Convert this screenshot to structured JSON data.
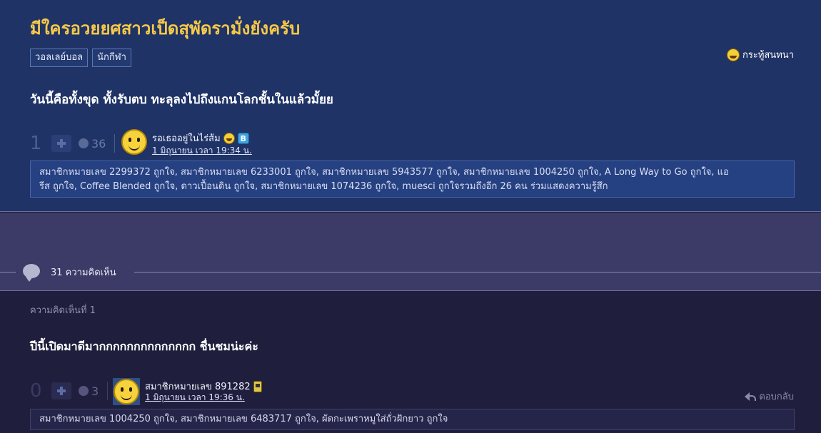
{
  "topic": {
    "title": "มีใครอวยยศสาวเป็ดสุพัดรามั่งยังครับ",
    "tags": [
      "วอลเลย์บอล",
      "นักกีฬา"
    ],
    "type_label": "กระทู้สนทนา",
    "subtitle": "วันนี้คือทั้งขุด ทั้งรับตบ ทะลุลงไปถึงแกนโลกชั้นในแล้วมั้ยย",
    "votes": "1",
    "reactions": "36",
    "author": "รอเธออยู่ในไร่ส้ม",
    "date": "1 มิถุนายน เวลา 19:34 น.",
    "likes_line1": "สมาชิกหมายเลข 2299372 ถูกใจ, สมาชิกหมายเลข 6233001 ถูกใจ, สมาชิกหมายเลข 5943577 ถูกใจ, สมาชิกหมายเลข 1004250 ถูกใจ, A Long Way to Go ถูกใจ, แอ",
    "likes_line2": "รีส ถูกใจ, Coffee Blended ถูกใจ, ดาวเปื้อนดิน ถูกใจ, สมาชิกหมายเลข 1074236 ถูกใจ, muesci ถูกใจรวมถึงอีก 26 คน ร่วมแสดงความรู้สึก"
  },
  "comments_count": "31 ความคิดเห็น",
  "comment": {
    "label": "ความคิดเห็นที่ 1",
    "text": "ปีนี้เปิดมาดีมากกกกกกกกกกกกกก ชื่นชมน่ะค่ะ",
    "votes": "0",
    "reactions": "3",
    "author": "สมาชิกหมายเลข 891282",
    "date": "1 มิถุนายน เวลา 19:36 น.",
    "reply_label": "ตอบกลับ",
    "likes": "สมาชิกหมายเลข 1004250 ถูกใจ, สมาชิกหมายเลข 6483717 ถูกใจ, ผัดกะเพราหมูใส่ถั่วฝักยาว ถูกใจ"
  },
  "colors": {
    "topic_bg": "#1f3366",
    "title": "#f7c948",
    "comment_bg": "#1f1f3d"
  },
  "icons": {
    "type": "laughing-emoji-icon",
    "badge": "blog-badge-icon",
    "comment_badge": "mobile-badge-icon",
    "comments": "speech-bubble-icon",
    "reply": "reply-arrow-icon"
  }
}
